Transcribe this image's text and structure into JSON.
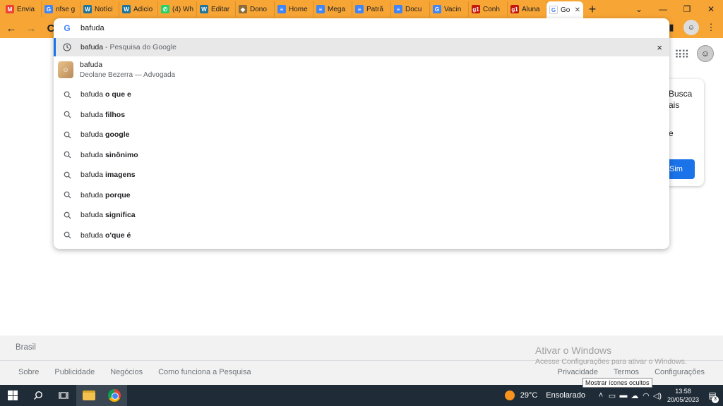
{
  "browser": {
    "tabs": [
      {
        "label": "Envia",
        "favicon": "gmail-icon",
        "color": "#ea4335",
        "glyph": "M"
      },
      {
        "label": "nfse g",
        "favicon": "google-icon",
        "color": "#4285f4",
        "glyph": "G"
      },
      {
        "label": "Notíci",
        "favicon": "wordpress-icon",
        "color": "#21759b",
        "glyph": "W"
      },
      {
        "label": "Adicio",
        "favicon": "wordpress-icon",
        "color": "#21759b",
        "glyph": "W"
      },
      {
        "label": "(4) Wh",
        "favicon": "whatsapp-icon",
        "color": "#25d366",
        "glyph": "✆"
      },
      {
        "label": "Editar",
        "favicon": "wordpress-icon",
        "color": "#21759b",
        "glyph": "W"
      },
      {
        "label": "Dono",
        "favicon": "site-icon",
        "color": "#8a6d3b",
        "glyph": "◆"
      },
      {
        "label": "Home",
        "favicon": "docs-icon",
        "color": "#4285f4",
        "glyph": "≡"
      },
      {
        "label": "Mega",
        "favicon": "docs-icon",
        "color": "#4285f4",
        "glyph": "≡"
      },
      {
        "label": "Patrã",
        "favicon": "docs-icon",
        "color": "#4285f4",
        "glyph": "≡"
      },
      {
        "label": "Docu",
        "favicon": "docs-icon",
        "color": "#4285f4",
        "glyph": "≡"
      },
      {
        "label": "Vacin",
        "favicon": "google-icon",
        "color": "#4285f4",
        "glyph": "G"
      },
      {
        "label": "Conh",
        "favicon": "g1-icon",
        "color": "#c4170c",
        "glyph": "g1"
      },
      {
        "label": "Aluna",
        "favicon": "g1-icon",
        "color": "#c4170c",
        "glyph": "g1"
      }
    ],
    "active_tab": {
      "label": "Go",
      "favicon": "google-icon",
      "close": "✕"
    },
    "new_tab": "+",
    "window_controls": {
      "dropdown": "⌄",
      "minimize": "—",
      "restore": "❐",
      "close": "✕"
    },
    "nav": {
      "back": "←",
      "forward": "→",
      "reload": "C"
    }
  },
  "omnibox": {
    "input_value": "bafuda",
    "history_row": {
      "query": "bafuda",
      "suffix": " - Pesquisa do Google",
      "remove": "×"
    },
    "entity_row": {
      "title": "bafuda",
      "description": "Deolane Bezerra — Advogada"
    },
    "suggestions": [
      {
        "base": "bafuda ",
        "bold": "o que e"
      },
      {
        "base": "bafuda ",
        "bold": "filhos"
      },
      {
        "base": "bafuda ",
        "bold": "google"
      },
      {
        "base": "bafuda ",
        "bold": "sinônimo"
      },
      {
        "base": "bafuda ",
        "bold": "imagens"
      },
      {
        "base": "bafuda ",
        "bold": "porque"
      },
      {
        "base": "bafuda ",
        "bold": "significa"
      },
      {
        "base": "bafuda ",
        "bold": "o'que é"
      }
    ]
  },
  "page": {
    "promo": {
      "line1": "Busca",
      "line2": "ais",
      "line3": "e",
      "button": "Sim"
    }
  },
  "footer": {
    "country": "Brasil",
    "links_left": [
      "Sobre",
      "Publicidade",
      "Negócios",
      "Como funciona a Pesquisa"
    ],
    "links_right": [
      "Privacidade",
      "Termos",
      "Configurações"
    ]
  },
  "watermark": {
    "title": "Ativar o Windows",
    "subtitle": "Acesse Configurações para ativar o Windows."
  },
  "tooltip": "Mostrar ícones ocultos",
  "taskbar": {
    "weather_temp": "29°C",
    "weather_desc": "Ensolarado",
    "time": "13:58",
    "date": "20/05/2023",
    "notification_count": "3"
  }
}
